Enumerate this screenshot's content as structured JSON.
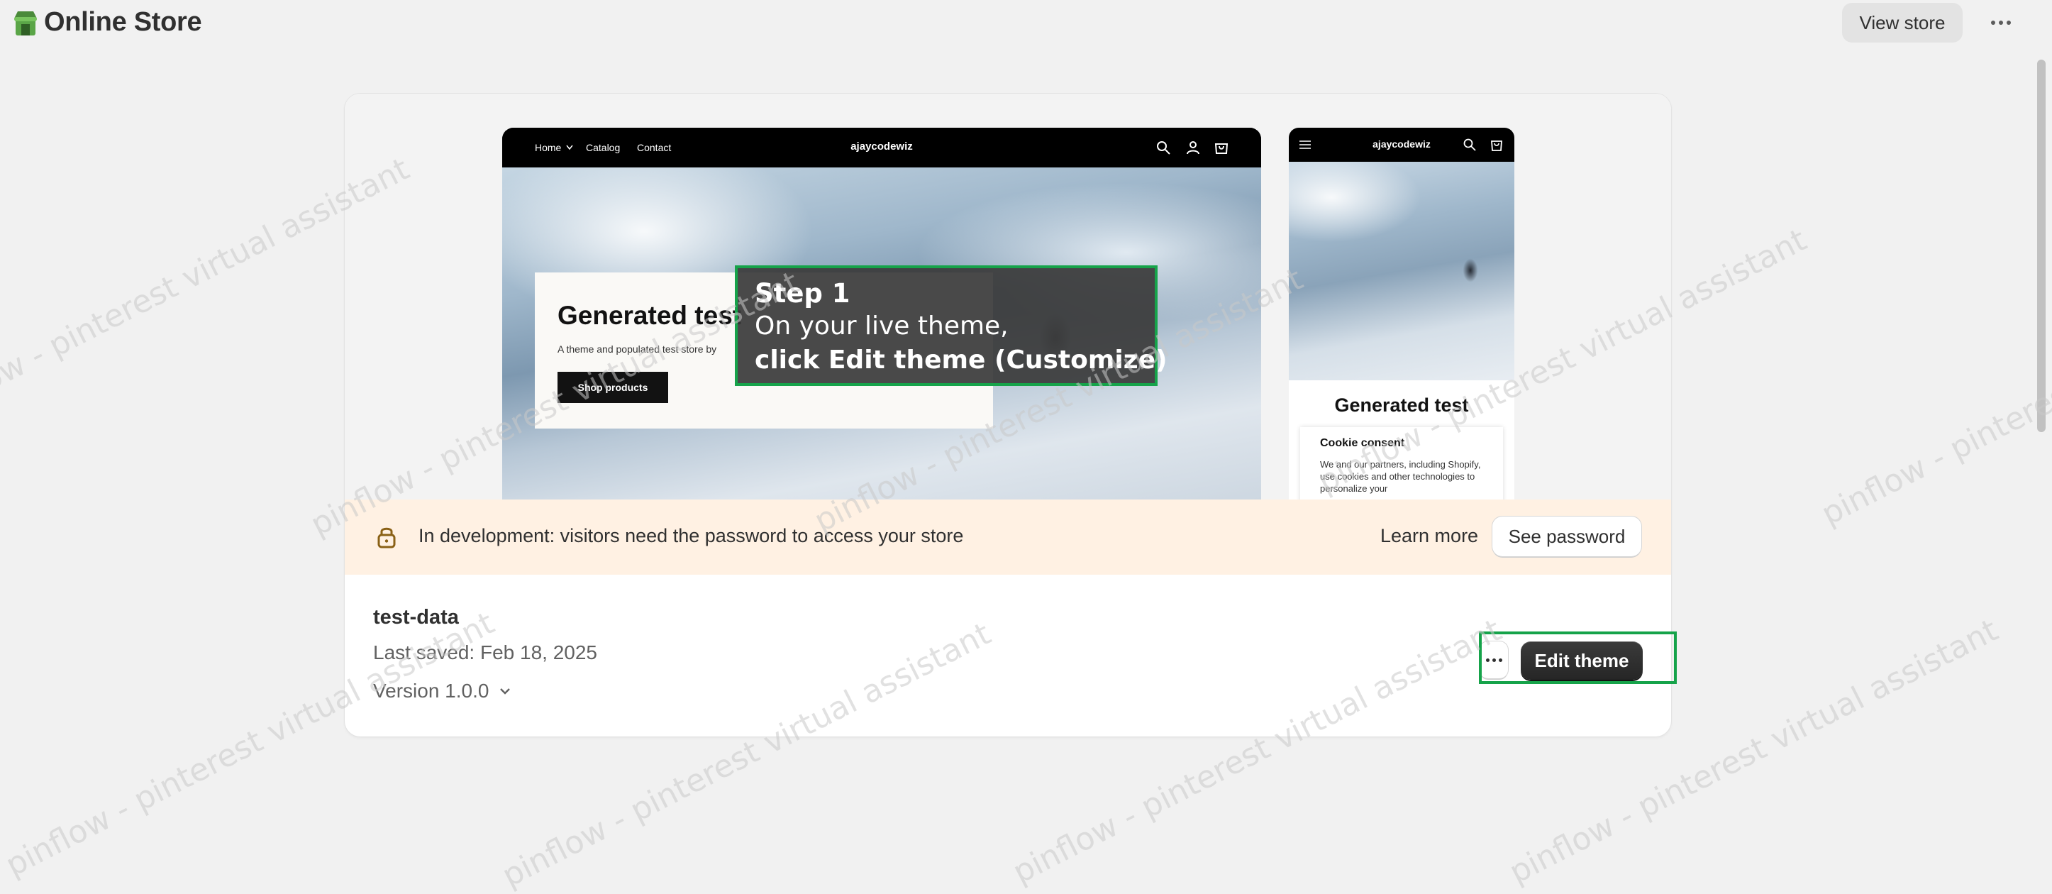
{
  "app": {
    "title": "Online Store",
    "view_store_label": "View store"
  },
  "theme": {
    "preview": {
      "desktop": {
        "nav_links": [
          "Home",
          "Catalog",
          "Contact"
        ],
        "brand": "ajaycodewiz",
        "hero_title": "Generated test",
        "hero_subtitle": "A theme and populated test store by",
        "hero_button": "Shop products"
      },
      "mobile": {
        "brand": "ajaycodewiz",
        "hero_title": "Generated test",
        "cookie_title": "Cookie consent",
        "cookie_body": "We and our partners, including Shopify, use cookies and other technologies to personalize your"
      }
    },
    "banner": {
      "text": "In development: visitors need the password to access your store",
      "learn_more": "Learn more",
      "see_password": "See password"
    },
    "name": "test-data",
    "last_saved": "Last saved: Feb 18, 2025",
    "version": "Version 1.0.0",
    "edit_label": "Edit theme"
  },
  "tutorial": {
    "step_title": "Step 1",
    "line1": "On your live theme,",
    "line2": "click Edit theme (Customize)"
  },
  "watermark": {
    "text": "pinflow  -  pinterest virtual assistant"
  },
  "colors": {
    "highlight": "#16a34a",
    "banner_bg": "#fff1e3",
    "page_bg": "#f1f1f1"
  }
}
